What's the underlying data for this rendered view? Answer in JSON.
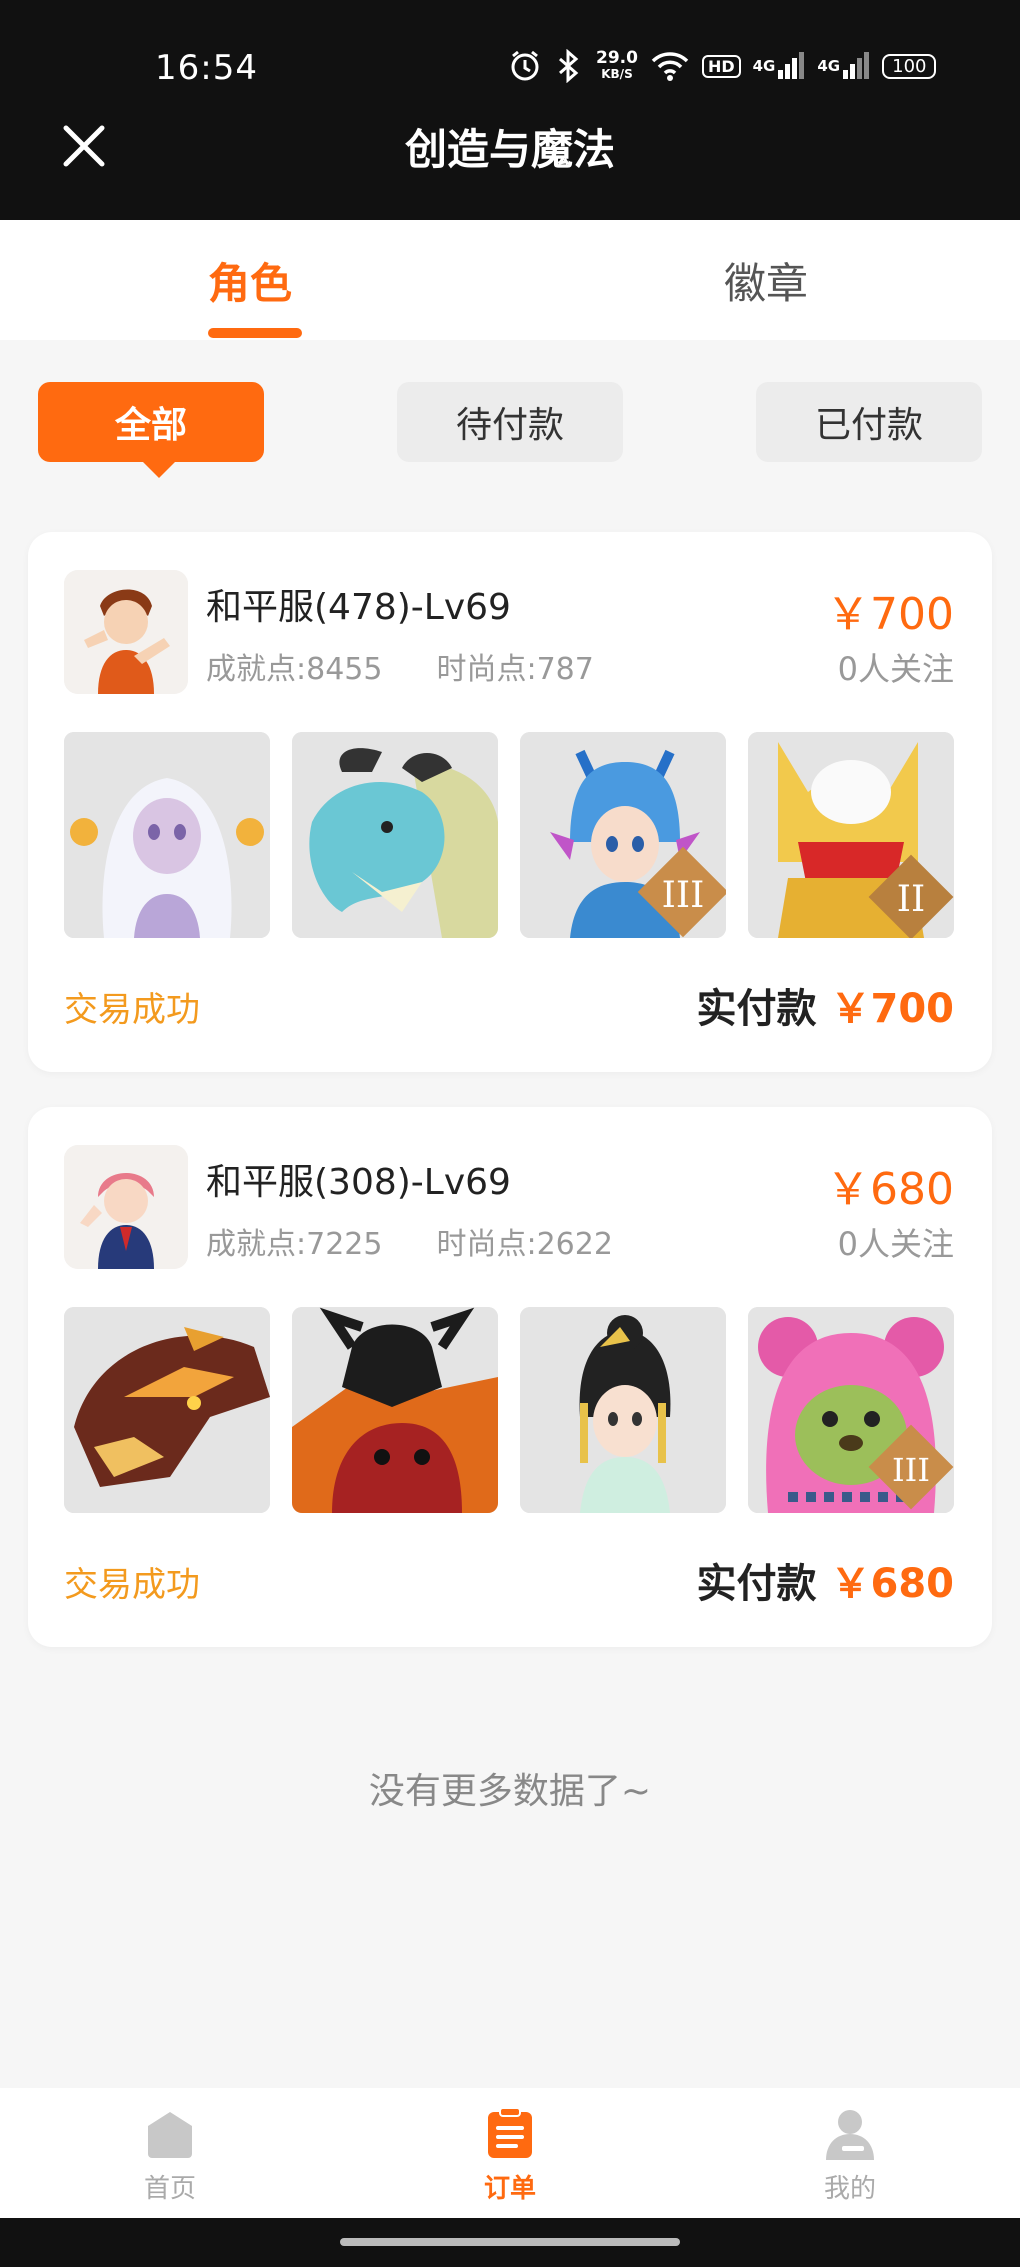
{
  "status_bar": {
    "time": "16:54",
    "net_speed_value": "29.0",
    "net_speed_unit": "KB/S",
    "hd_label": "HD",
    "signal_1": "4G",
    "signal_2": "4G",
    "battery": "100"
  },
  "header": {
    "title": "创造与魔法"
  },
  "tabs": [
    {
      "label": "角色",
      "active": true
    },
    {
      "label": "徽章",
      "active": false
    }
  ],
  "filters": [
    {
      "label": "全部",
      "active": true
    },
    {
      "label": "待付款",
      "active": false
    },
    {
      "label": "已付款",
      "active": false
    }
  ],
  "orders": [
    {
      "server": "和平服(478)-Lv69",
      "achievement": "成就点:8455",
      "fashion": "时尚点:787",
      "price": "￥700",
      "followers": "0人关注",
      "status": "交易成功",
      "paid_label": "实付款",
      "paid_amount": "￥700",
      "thumbnails": [
        "white-haired-girl-icon",
        "ice-dragon-icon",
        "blue-dragon-boy-icon",
        "golden-armor-icon"
      ],
      "thumbnail_badges": [
        "",
        "",
        "III",
        "II"
      ]
    },
    {
      "server": "和平服(308)-Lv69",
      "achievement": "成就点:7225",
      "fashion": "时尚点:2622",
      "price": "￥680",
      "followers": "0人关注",
      "status": "交易成功",
      "paid_label": "实付款",
      "paid_amount": "￥680",
      "thumbnails": [
        "fire-dragon-icon",
        "black-beast-icon",
        "princess-icon",
        "pink-bear-icon"
      ],
      "thumbnail_badges": [
        "",
        "",
        "",
        "III"
      ]
    }
  ],
  "footer_note": "没有更多数据了~",
  "bottom_nav": [
    {
      "label": "首页",
      "icon": "home-icon",
      "active": false
    },
    {
      "label": "订单",
      "icon": "order-icon",
      "active": true
    },
    {
      "label": "我的",
      "icon": "profile-icon",
      "active": false
    }
  ],
  "colors": {
    "accent": "#ff6a10",
    "success": "#f39a1e",
    "header": "#111111"
  }
}
